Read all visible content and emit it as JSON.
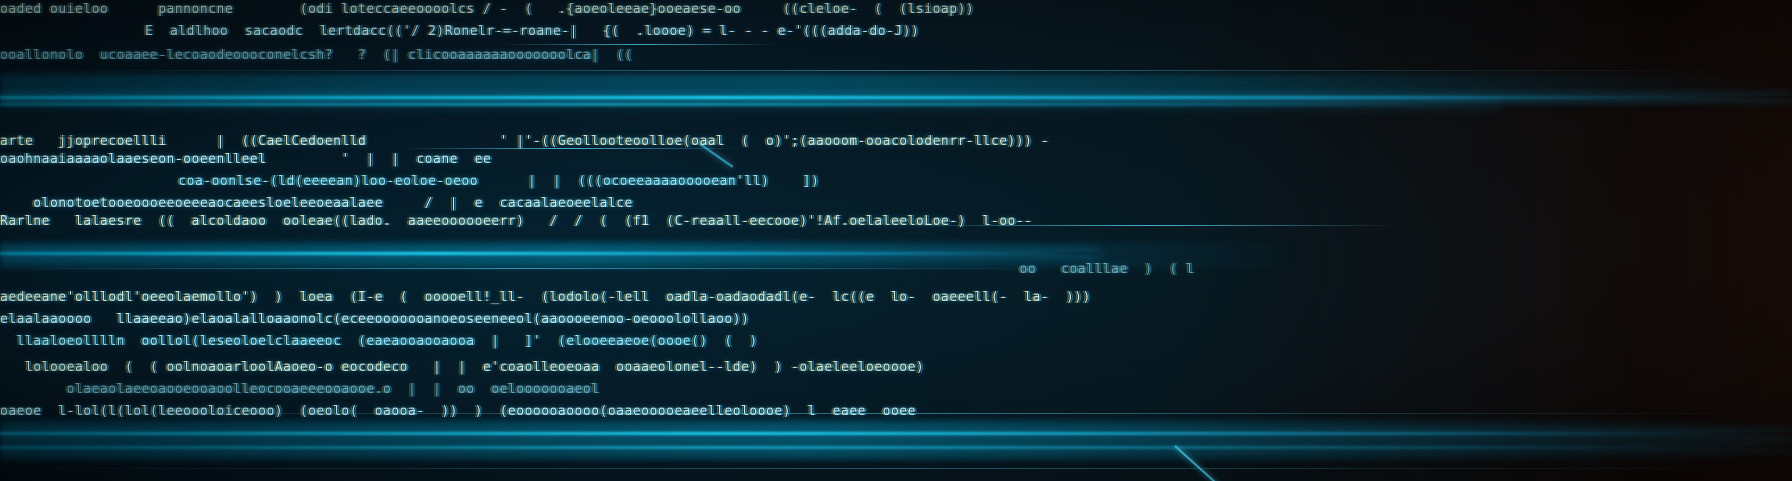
{
  "code_lines": [
    "oaded ouieloo      pannoncne        (odi loteccaeeoooolcs / -  (   .{aoeoleeae}ooeaese-oo     ((cleloe-  (  (lsioap))",
    "   E  aldlhoo  sacaodc  lertdacc(('/ 2)Ronelr-=-roane-|   {(  .loooe) = l- - - e-'(((adda-do-J))",
    "ooallonolo  ucoaaee-lecoaodeoooconelcsh?   ?  (| clicooaaaaaaooooooolca|  ((",
    "arte   jjoprecoellli      |  ((CaelCedoenlld                ' |'-((Geollooteoolloe(oaal  (  o)';(aaooom-ooacolodenrr-llce))) -",
    "oaohnaaiaaaaolaaeseon-ooeenlleel         '  |  |  coane  ee",
    "       coa-oonlse-(ld(eeeean)loo-eoloe-oeoo      |  |  (((ocoeeaaaaooooean'll)    ])",
    "    olonotoetooeoooeeoeeeaocaeesloeleeoeaalaee     /  |  e  cacaalaeoeelalce",
    "Rarlne   lalaesre  ((  alcoldaoo  ooleae((lado.  aaeeoooooeerr)   /  /  (  (f1  (C-reaall-eecooe)'!Af.oelaleeloLoe-)  l-oo--",
    "                                                                        oo   coalllae  )  ( l",
    "aedeeane'olllodl'oeeolaemollo')  )  loea  (I-e  (  ooooell!_ll-  (lodolo(-lell  oadla-oadaodadl(e-  lc((e  lo-  oaeeell(-  la-  )))",
    "elaalaaoooo   llaaeeao)elaoalalloaaonolc(eceeooooooanoeoseeneeol(aaoooeenoo-oeooolollaoo))",
    "  llaaloeolllln  oollol(leseoloelclaaeeoc  (eaeaooaooaooa  |   ]'  (elooeeaeoe(oooe()  (  )",
    "   lolooealoo  (  ( oolnoaoarloolAaoeo-o eocodeco   |  |  e'coaolleoeoaa  ooaaeolonel--lde)  ) -olaeleeloeoooe)",
    "        olaeaolaeeoaooeooaoolleocooaeeeooaooe.o  |  |  oo  oelooooooaeol",
    "oaeoe  l-lol(l(lol(leeoooloiceooo)  (oeolo(  oaooa-  ))  )  (eoooooaoooo(oaaeooooeaeelleoloooe)  l  eaee  ooee"
  ]
}
